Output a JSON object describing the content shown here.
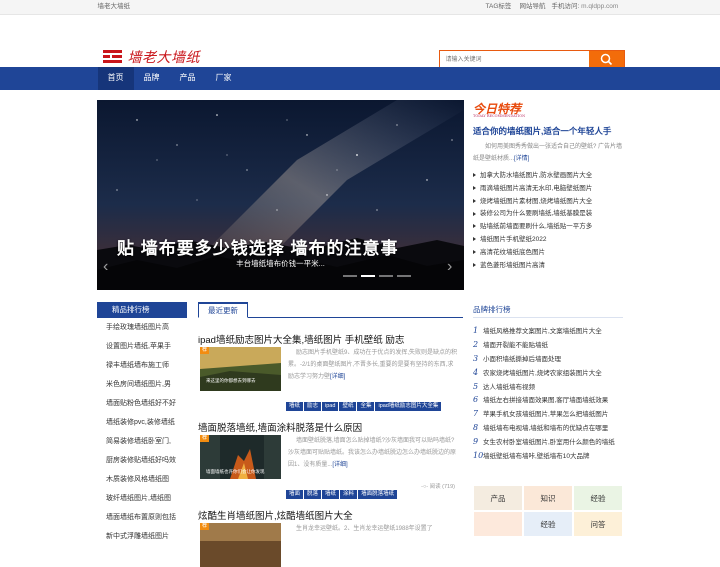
{
  "topbar": {
    "site_name": "墙老大墙纸",
    "tag_link": "TAG标签",
    "nav_link": "网站导航",
    "mobile_label": "手机访问:",
    "mobile_url": "m.qldpp.com"
  },
  "header": {
    "logo_text": "墙老大墙纸",
    "search_placeholder": "请输入关键词",
    "brand_color": "#c9161b"
  },
  "nav": {
    "items": [
      "首页",
      "品牌",
      "产品",
      "厂家"
    ],
    "active": "首页",
    "bg": "#1f4597"
  },
  "banner": {
    "image_text": "贴 墙布要多少钱选择 墙布的注意事",
    "caption": "丰台墙纸墙布价钱一平米...",
    "prev_glyph": "‹",
    "next_glyph": "›"
  },
  "today": {
    "logo": "今日特荐",
    "logo_sub": "TODAY RECOMMENDATION",
    "title": "适合你的墙纸图片,适合一个年轻人手",
    "desc": "如何用美图秀秀做出一张适合自己的壁纸? 广告片墙纸是壁纸材质...",
    "more": "[详情]",
    "list": [
      "加拿大防水墙纸图片,防水壁画图片大全",
      "雨滴墙纸图片高清无水印,电脑壁纸图片",
      "烧烤墙纸图片素材图,烧烤墙纸图片大全",
      "装修公司为什么要刷墙纸,墙纸基膜是装",
      "贴墙纸前墙面要刷什么,墙纸贴一平方多",
      "墙纸图片手机壁纸2022",
      "高清花纹墙纸底色图片",
      "蓝色菱形墙纸图片高清"
    ]
  },
  "rank": {
    "title": "精品排行榜",
    "items": [
      "手绘玫瑰墙纸图片高",
      "设置图片墙纸,苹果手",
      "禄丰墙纸墙布施工师",
      "米色房间墙纸图片,男",
      "墙面贴粉色墙纸好不好",
      "墙纸装修pvc,装修墙纸",
      "简易装修墙纸卧室门,",
      "厨房装修贴墙纸好吗效",
      "木质装修风格墙纸图",
      "玻纤墙纸图片,墙纸图",
      "墙面墙纸布置原则包括",
      "新中式浮雕墙纸图片"
    ]
  },
  "latest": {
    "title": "最近更新",
    "articles": [
      {
        "title": "ipad墙纸励志图片大全集,墙纸图片 手机壁纸 励志",
        "badge": "荐",
        "image_caption": "来这里的你都想去到哪去",
        "desc": "励志图片手机壁纸9、成功在于优点的发挥,失败则是缺点的积累。-2/1的桌面壁纸图片,不晋多长,重要的是要有坚持的东西,求励志学习努力壁",
        "more": "[详细]",
        "tags": [
          "墙纸",
          "励志",
          "ipad",
          "壁纸",
          "全集",
          "ipad墙纸励志图片大全集"
        ],
        "meta": ""
      },
      {
        "title": "墙面脱落墙纸,墙面涂料脱落是什么原因",
        "badge": "荐",
        "image_caption": "墙面墙纸也许你们会让你发现",
        "desc": "墙面壁纸脱落,墙面怎么贴掉墙纸?沙灰墙面我可以贴吗墙纸?沙灰墙面可贴贴墙纸。我该怎么办墙纸脱边怎么办墙纸脱边的原因1、没有质量...",
        "more": "[详细]",
        "tags": [
          "墙面",
          "脱落",
          "墙纸",
          "涂料",
          "墙面脱落墙纸"
        ],
        "meta": "-○- 阅读 (719)"
      },
      {
        "title": "炫酷生肖墙纸图片,炫酷墙纸图片大全",
        "badge": "荐",
        "image_caption": "",
        "desc": "生肖龙幸运壁纸。2、生肖龙幸运壁纸1988年设置了",
        "more": "",
        "tags": [],
        "meta": ""
      }
    ]
  },
  "brand_rank": {
    "title": "品牌排行榜",
    "items": [
      "墙纸风格推荐文案图片,文案墙纸图片大全",
      "墙面开裂能不能贴墙纸",
      "小面积墙纸撕掉后墙面处理",
      "农家烧烤墙纸图片,烧烤农家组装图片大全",
      "达人墙纸墙布视频",
      "墙纸左右拼接墙面效果图,客厅墙面墙纸效果",
      "苹果手机女孩墙纸图片,苹果怎么把墙纸图片",
      "墙纸墙布电视墙,墙纸和墙布的优缺点在哪里",
      "女生农村卧室墙纸图片,卧室用什么颜色的墙纸",
      "墙纸壁纸墙布墙咔,壁纸墙布10大品牌"
    ]
  },
  "grid": {
    "rows": [
      [
        "产品",
        "知识",
        "经验"
      ],
      [
        "",
        "经验",
        "问答"
      ]
    ]
  }
}
